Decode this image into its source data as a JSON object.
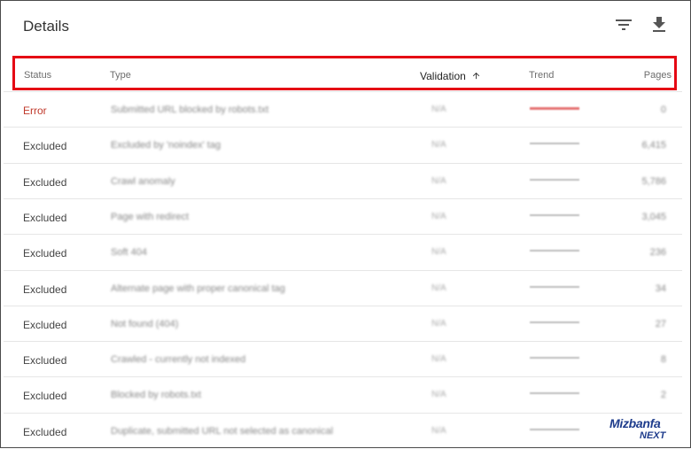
{
  "header": {
    "title": "Details",
    "filter_icon": "filter-list-icon",
    "download_icon": "download-icon"
  },
  "columns": {
    "status": "Status",
    "type": "Type",
    "validation": "Validation",
    "trend": "Trend",
    "pages": "Pages",
    "sort_icon": "arrow-upward-icon"
  },
  "colors": {
    "error": "#c0392b",
    "highlight_border": "#e50914",
    "trend_error": "#e57373",
    "trend_normal": "#bdbdbd"
  },
  "rows": [
    {
      "status": "Error",
      "type": "Submitted URL blocked by robots.txt",
      "validation": "N/A",
      "pages": "0"
    },
    {
      "status": "Excluded",
      "type": "Excluded by 'noindex' tag",
      "validation": "N/A",
      "pages": "6,415"
    },
    {
      "status": "Excluded",
      "type": "Crawl anomaly",
      "validation": "N/A",
      "pages": "5,786"
    },
    {
      "status": "Excluded",
      "type": "Page with redirect",
      "validation": "N/A",
      "pages": "3,045"
    },
    {
      "status": "Excluded",
      "type": "Soft 404",
      "validation": "N/A",
      "pages": "236"
    },
    {
      "status": "Excluded",
      "type": "Alternate page with proper canonical tag",
      "validation": "N/A",
      "pages": "34"
    },
    {
      "status": "Excluded",
      "type": "Not found (404)",
      "validation": "N/A",
      "pages": "27"
    },
    {
      "status": "Excluded",
      "type": "Crawled - currently not indexed",
      "validation": "N/A",
      "pages": "8"
    },
    {
      "status": "Excluded",
      "type": "Blocked by robots.txt",
      "validation": "N/A",
      "pages": "2"
    },
    {
      "status": "Excluded",
      "type": "Duplicate, submitted URL not selected as canonical",
      "validation": "N/A",
      "pages": ""
    }
  ],
  "watermark": {
    "line1": "Mizbanfa",
    "line2": "NEXT"
  }
}
